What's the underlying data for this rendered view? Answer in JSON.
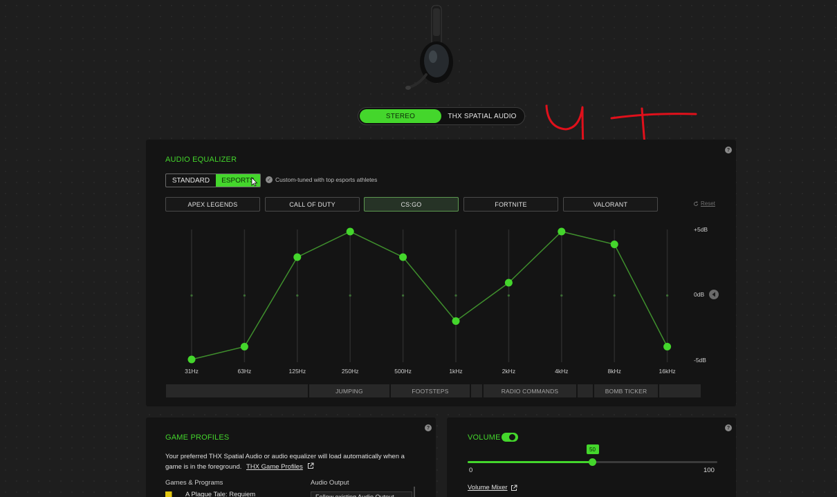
{
  "mode_toggle": {
    "stereo_label": "STEREO",
    "thx_label": "THX SPATIAL AUDIO",
    "active": "stereo"
  },
  "equalizer": {
    "title": "AUDIO EQUALIZER",
    "preset_standard": "STANDARD",
    "preset_esports": "ESPORTS",
    "note": "Custom-tuned with top esports athletes",
    "games": [
      "APEX LEGENDS",
      "CALL OF DUTY",
      "CS:GO",
      "FORTNITE",
      "VALORANT"
    ],
    "active_game": "CS:GO",
    "reset_label": "Reset",
    "bands": [
      {
        "freq": "31Hz",
        "db": -5
      },
      {
        "freq": "63Hz",
        "db": -4
      },
      {
        "freq": "125Hz",
        "db": 3
      },
      {
        "freq": "250Hz",
        "db": 5
      },
      {
        "freq": "500Hz",
        "db": 3
      },
      {
        "freq": "1kHz",
        "db": -2
      },
      {
        "freq": "2kHz",
        "db": 1
      },
      {
        "freq": "4kHz",
        "db": 5
      },
      {
        "freq": "8kHz",
        "db": 4
      },
      {
        "freq": "16kHz",
        "db": -4
      }
    ],
    "db_top": "+5dB",
    "db_mid": "0dB",
    "db_bottom": "-5dB",
    "sound_cues": [
      "",
      "JUMPING",
      "FOOTSTEPS",
      "",
      "RADIO COMMANDS",
      "",
      "BOMB TICKER",
      ""
    ]
  },
  "game_profiles": {
    "title": "GAME PROFILES",
    "description": "Your preferred THX Spatial Audio or audio equalizer will load automatically when a game is in the foreground.",
    "link": "THX Game Profiles",
    "col_games": "Games & Programs",
    "col_output": "Audio Output",
    "first_game": "A Plague Tale: Requiem",
    "first_output": "Follow existing Audio Output"
  },
  "volume": {
    "title": "VOLUME",
    "value": 50,
    "min": "0",
    "max": "100",
    "mixer_link": "Volume Mixer",
    "enabled": true
  },
  "colors": {
    "accent": "#44d62c",
    "annotation": "#e0101b"
  }
}
